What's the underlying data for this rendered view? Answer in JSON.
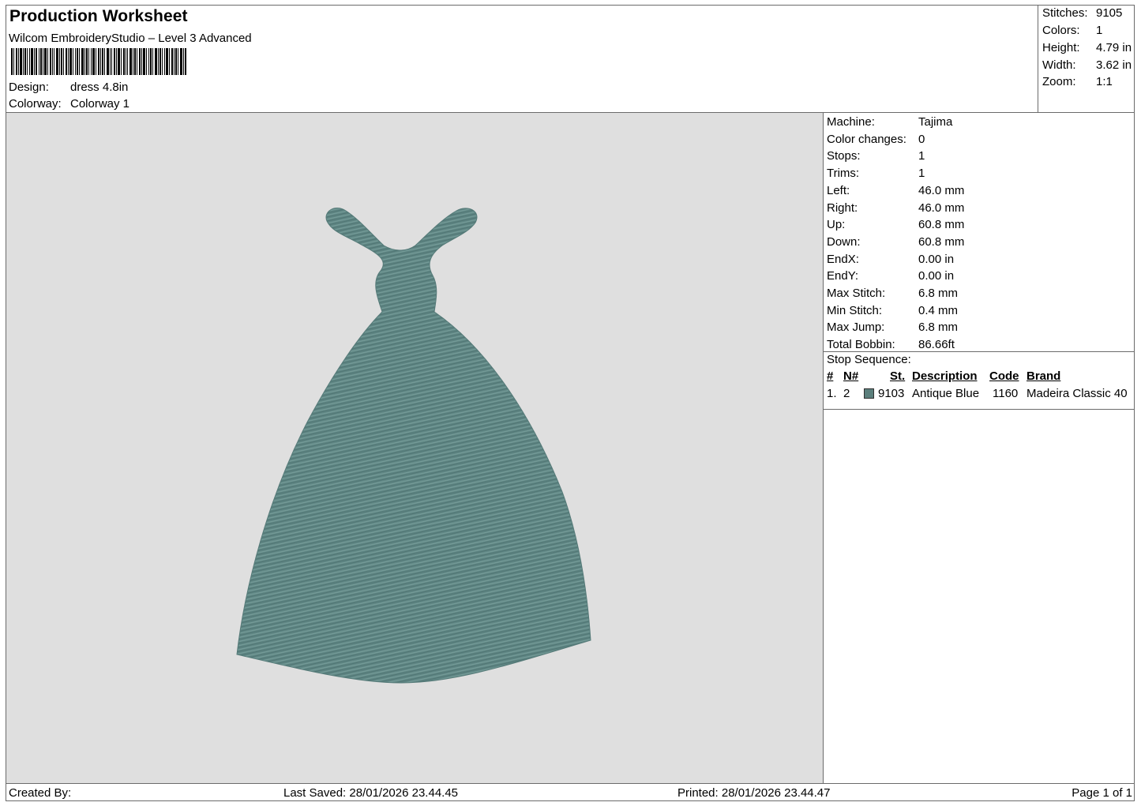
{
  "header": {
    "title": "Production Worksheet",
    "subtitle": "Wilcom EmbroideryStudio – Level 3 Advanced",
    "design_label": "Design:",
    "design_value": "dress 4.8in",
    "colorway_label": "Colorway:",
    "colorway_value": "Colorway 1"
  },
  "summary": {
    "stitches_label": "Stitches:",
    "stitches_value": "9105",
    "colors_label": "Colors:",
    "colors_value": "1",
    "height_label": "Height:",
    "height_value": "4.79 in",
    "width_label": "Width:",
    "width_value": "3.62 in",
    "zoom_label": "Zoom:",
    "zoom_value": "1:1"
  },
  "machine_info": [
    {
      "label": "Machine:",
      "value": "Tajima"
    },
    {
      "label": "Color changes:",
      "value": "0"
    },
    {
      "label": "Stops:",
      "value": "1"
    },
    {
      "label": "Trims:",
      "value": "1"
    },
    {
      "label": "Left:",
      "value": "46.0 mm"
    },
    {
      "label": "Right:",
      "value": "46.0 mm"
    },
    {
      "label": "Up:",
      "value": "60.8 mm"
    },
    {
      "label": "Down:",
      "value": "60.8 mm"
    },
    {
      "label": "EndX:",
      "value": "0.00 in"
    },
    {
      "label": "EndY:",
      "value": "0.00 in"
    },
    {
      "label": "Max Stitch:",
      "value": "6.8 mm"
    },
    {
      "label": "Min Stitch:",
      "value": "0.4 mm"
    },
    {
      "label": "Max Jump:",
      "value": "6.8 mm"
    },
    {
      "label": "Total Bobbin:",
      "value": "86.66ft"
    }
  ],
  "stop_sequence": {
    "title": "Stop Sequence:",
    "headers": {
      "num": "#",
      "n": "N#",
      "st": "St.",
      "description": "Description",
      "code": "Code",
      "brand": "Brand"
    },
    "rows": [
      {
        "num": "1.",
        "n": "2",
        "st": "9103",
        "description": "Antique Blue",
        "code": "1160",
        "brand": "Madeira Classic 40",
        "color": "#5b7f7c"
      }
    ]
  },
  "footer": {
    "created_by": "Created By:",
    "last_saved": "Last Saved: 28/01/2026 23.44.45",
    "printed": "Printed: 28/01/2026 23.44.47",
    "page": "Page 1 of 1"
  },
  "colors": {
    "preview_background": "#dfdfdf",
    "thread": "#5e8583",
    "border": "#6b6b6b"
  }
}
